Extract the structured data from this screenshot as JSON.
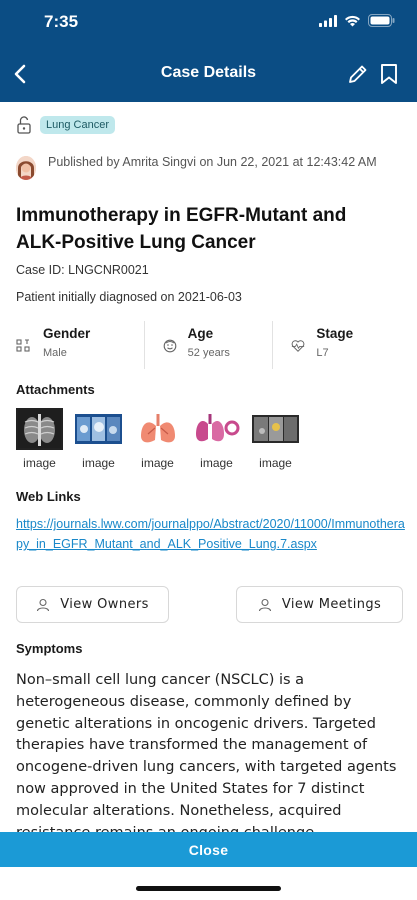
{
  "status_bar": {
    "time": "7:35"
  },
  "navbar": {
    "title": "Case Details"
  },
  "case": {
    "tag": "Lung Cancer",
    "published": "Published by Amrita Singvi on Jun 22, 2021 at 12:43:42 AM",
    "title": "Immunotherapy in EGFR-Mutant and ALK-Positive Lung Cancer",
    "case_id": "Case ID: LNGCNR0021",
    "diagnosed": "Patient initially diagnosed on 2021-06-03"
  },
  "stats": [
    {
      "label": "Gender",
      "value": "Male",
      "icon": "gender-icon"
    },
    {
      "label": "Age",
      "value": "52 years",
      "icon": "face-icon"
    },
    {
      "label": "Stage",
      "value": "L7",
      "icon": "heartbeat-icon"
    }
  ],
  "attachments": {
    "title": "Attachments",
    "items": [
      {
        "label": "image"
      },
      {
        "label": "image"
      },
      {
        "label": "image"
      },
      {
        "label": "image"
      },
      {
        "label": "image"
      }
    ]
  },
  "web_links": {
    "title": "Web Links",
    "url": "https://journals.lww.com/journalppo/Abstract/2020/11000/Immunotherapy_in_EGFR_Mutant_and_ALK_Positive_Lung.7.aspx"
  },
  "buttons": {
    "view_owners": "View Owners",
    "view_meetings": "View Meetings"
  },
  "symptoms": {
    "title": "Symptoms",
    "text": "Non–small cell lung cancer (NSCLC) is a heterogeneous disease, commonly defined by genetic alterations in oncogenic drivers. Targeted therapies have transformed the management of oncogene-driven lung cancers, with targeted agents now approved in the United States for 7 distinct molecular alterations. Nonetheless, acquired resistance remains an ongoing challenge."
  },
  "footer": {
    "close_label": "Close"
  },
  "colors": {
    "header": "#0b4d84",
    "accent": "#1b9ad6",
    "link": "#1a88c9",
    "tag_bg": "#bfe8ec"
  }
}
